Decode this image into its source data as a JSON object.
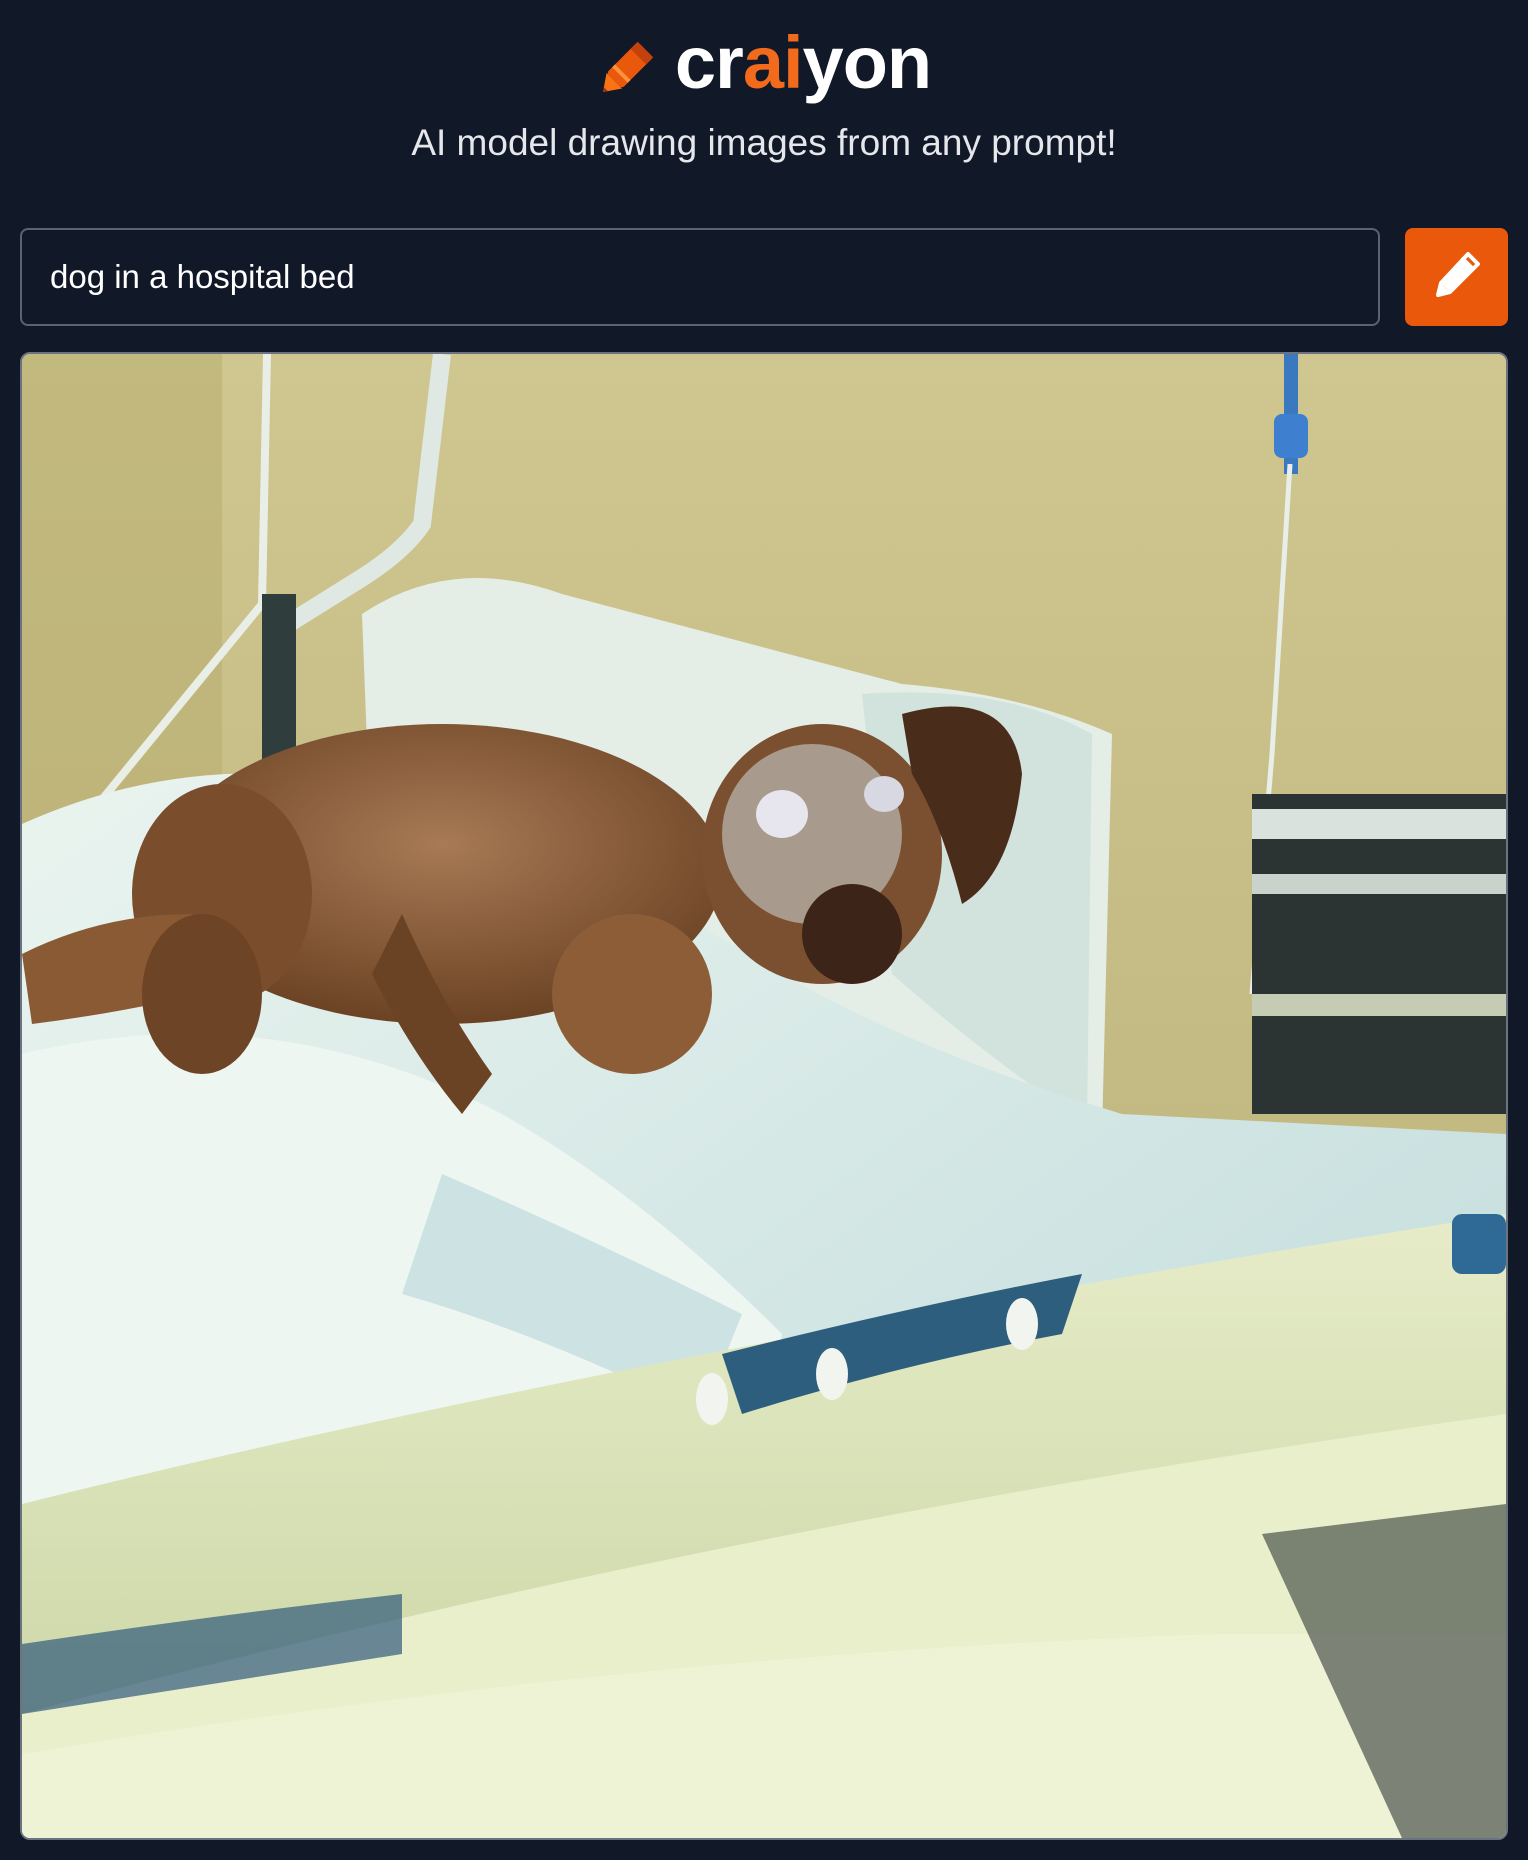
{
  "brand": {
    "prefix": "cr",
    "accent": "ai",
    "suffix": "yon",
    "accent_color": "#f26b1d"
  },
  "tagline": "AI model drawing images from any prompt!",
  "search": {
    "value": "dog in a hospital bed"
  },
  "draw_button": {
    "icon": "pencil-icon",
    "color": "#ea580c"
  },
  "result": {
    "image_subject": "dog in a hospital bed"
  },
  "colors": {
    "background": "#111827",
    "text": "#ffffff"
  }
}
